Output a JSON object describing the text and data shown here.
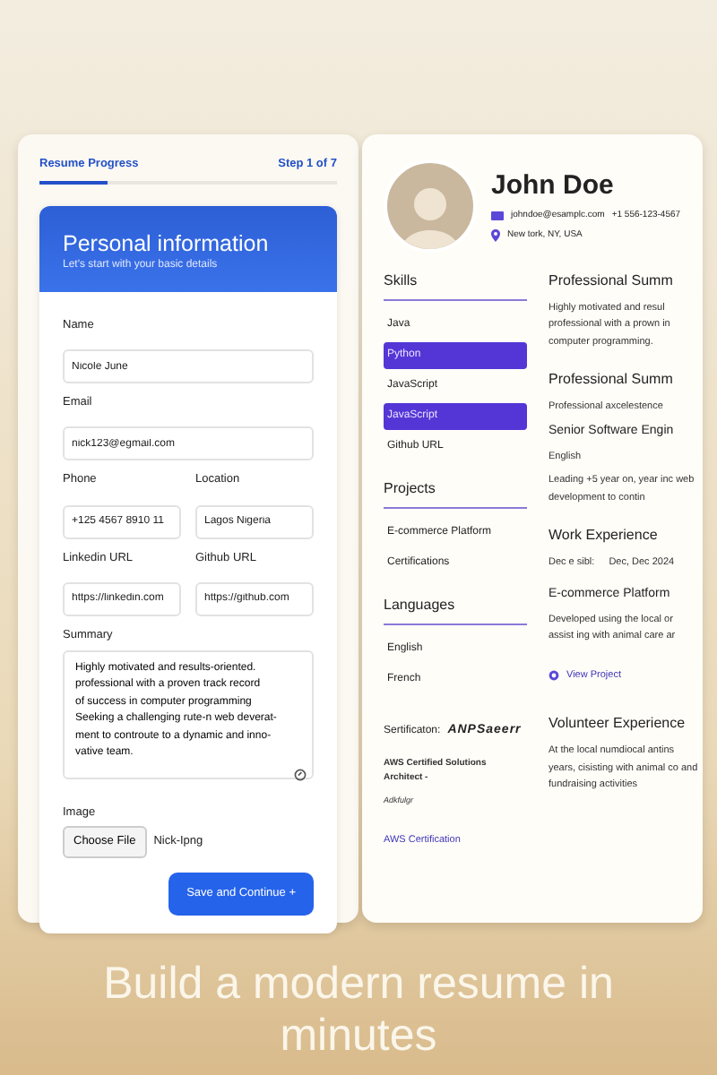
{
  "progress": {
    "label": "Resume Progress",
    "step": "Step 1 of 7",
    "level": 0.23
  },
  "form": {
    "title": "Personal information",
    "subtitle": "Let's start with your basic details",
    "fields": [
      {
        "kind": "text",
        "label": "Name",
        "value": "Nicole June"
      },
      {
        "kind": "text",
        "label": "Email",
        "value": "nick123@egmail.com"
      },
      {
        "kind": "pair",
        "items": [
          {
            "label": "Phone",
            "value": "+125 4567 8910 11"
          },
          {
            "label": "Location",
            "value": "Lagos Nigeria"
          }
        ]
      },
      {
        "kind": "pair",
        "items": [
          {
            "label": "Linkedin URL",
            "value": "https://linkedin.com"
          },
          {
            "label": "Github URL",
            "value": "https://github.com"
          }
        ]
      },
      {
        "kind": "textarea",
        "label": "Summary",
        "value": "Highly motivated and results-oriented.\nprofessional with a proven track record\nof success in computer programming\nSeeking a challenging rute-n web deverat-\nment to controute to a dynamic and inno-\nvative team."
      },
      {
        "kind": "file",
        "label": "Image",
        "button": "Choose File",
        "file": "Nick-Ipng"
      }
    ],
    "submit": "Save and Continue +"
  },
  "resume": {
    "name": "John Doe",
    "email": "johndoe@esamplc.com",
    "phone": "+1 556-123-4567",
    "location": "New tork, NY, USA",
    "side": [
      {
        "heading": "Skills",
        "items": [
          {
            "label": "Java",
            "selected": false
          },
          {
            "label": "Python",
            "selected": true
          },
          {
            "label": "JavaScript",
            "selected": false
          },
          {
            "label": "JavaScript",
            "selected": true
          },
          {
            "label": "Github URL",
            "selected": false
          }
        ]
      },
      {
        "heading": "Projects",
        "items": [
          {
            "label": "E-commerce Platform",
            "selected": false
          },
          {
            "label": "Certifications",
            "selected": false
          }
        ]
      },
      {
        "heading": "Languages",
        "items": [
          {
            "label": "English",
            "selected": false
          },
          {
            "label": "French",
            "selected": false
          }
        ]
      }
    ],
    "certification": {
      "label": "Sertificaton:",
      "logo": "ANPSaeerr",
      "title": "AWS Certified Solutions Architect -",
      "subtitle": "Adkfulgr",
      "link": "AWS Certification"
    },
    "main": [
      {
        "kind": "h2",
        "text": "Professional Summ"
      },
      {
        "kind": "p",
        "text": "Highly motivated and resul professional with a prown in computer programming."
      },
      {
        "kind": "h2",
        "text": "Professional Summ"
      },
      {
        "kind": "p",
        "text": "Professional axcelestence"
      },
      {
        "kind": "h3",
        "text": "Senior Software Engin"
      },
      {
        "kind": "p",
        "text": "English"
      },
      {
        "kind": "p",
        "text": "Leading +5 year on, year inc web development to contin"
      },
      {
        "kind": "h2",
        "text": "Work Experience"
      },
      {
        "kind": "meta",
        "text": "Dec e sibl:",
        "date": "Dec, Dec 2024"
      },
      {
        "kind": "h3",
        "text": "E-commerce Platform"
      },
      {
        "kind": "p",
        "text": "Developed using the local or assist ing with animal care ar"
      },
      {
        "kind": "link",
        "text": "View Project"
      },
      {
        "kind": "h2",
        "text": "Volunteer Experience"
      },
      {
        "kind": "p",
        "text": "At the local numdiocal antins years, cisisting with animal co and fundraising activities"
      }
    ]
  },
  "caption": "Build a modern resume in minutes"
}
